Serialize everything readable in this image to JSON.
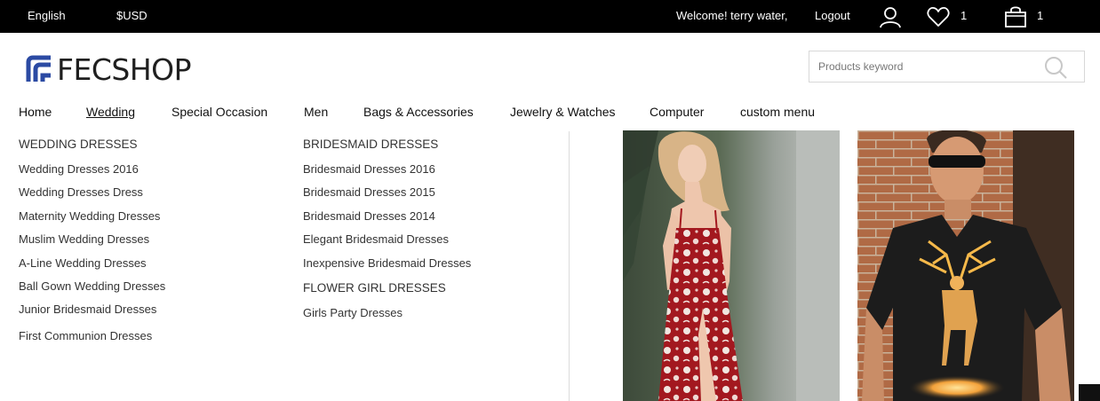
{
  "topbar": {
    "language": "English",
    "currency": "$USD",
    "welcome": "Welcome! terry water,",
    "logout": "Logout",
    "wishlist_count": "1",
    "cart_count": "1",
    "icons": {
      "account": "user-icon",
      "wishlist": "heart-icon",
      "cart": "shopping-bag-icon"
    }
  },
  "header": {
    "logo_text": "FECSHOP",
    "search_placeholder": "Products keyword",
    "search_icon": "search-icon"
  },
  "nav": {
    "items": [
      "Home",
      "Wedding",
      "Special Occasion",
      "Men",
      "Bags & Accessories",
      "Jewelry & Watches",
      "Computer",
      "custom menu"
    ],
    "active": "Wedding"
  },
  "mega_menu": {
    "col1": {
      "heading": "WEDDING DRESSES",
      "links": [
        "Wedding Dresses 2016",
        "Wedding Dresses Dress",
        "Maternity Wedding Dresses",
        "Muslim Wedding Dresses",
        "A-Line Wedding Dresses",
        "Ball Gown Wedding Dresses",
        "Junior Bridesmaid Dresses",
        "First Communion Dresses"
      ]
    },
    "col2": {
      "heading": "BRIDESMAID DRESSES",
      "links": [
        "Bridesmaid Dresses 2016",
        "Bridesmaid Dresses 2015",
        "Bridesmaid Dresses 2014",
        "Elegant Bridesmaid Dresses",
        "Inexpensive Bridesmaid Dresses"
      ],
      "heading2": "FLOWER GIRL DRESSES",
      "links2": [
        "Girls Party Dresses"
      ]
    }
  },
  "colors": {
    "topbar_bg": "#000000",
    "logo_accent": "#2b4aa3",
    "text": "#333333"
  }
}
